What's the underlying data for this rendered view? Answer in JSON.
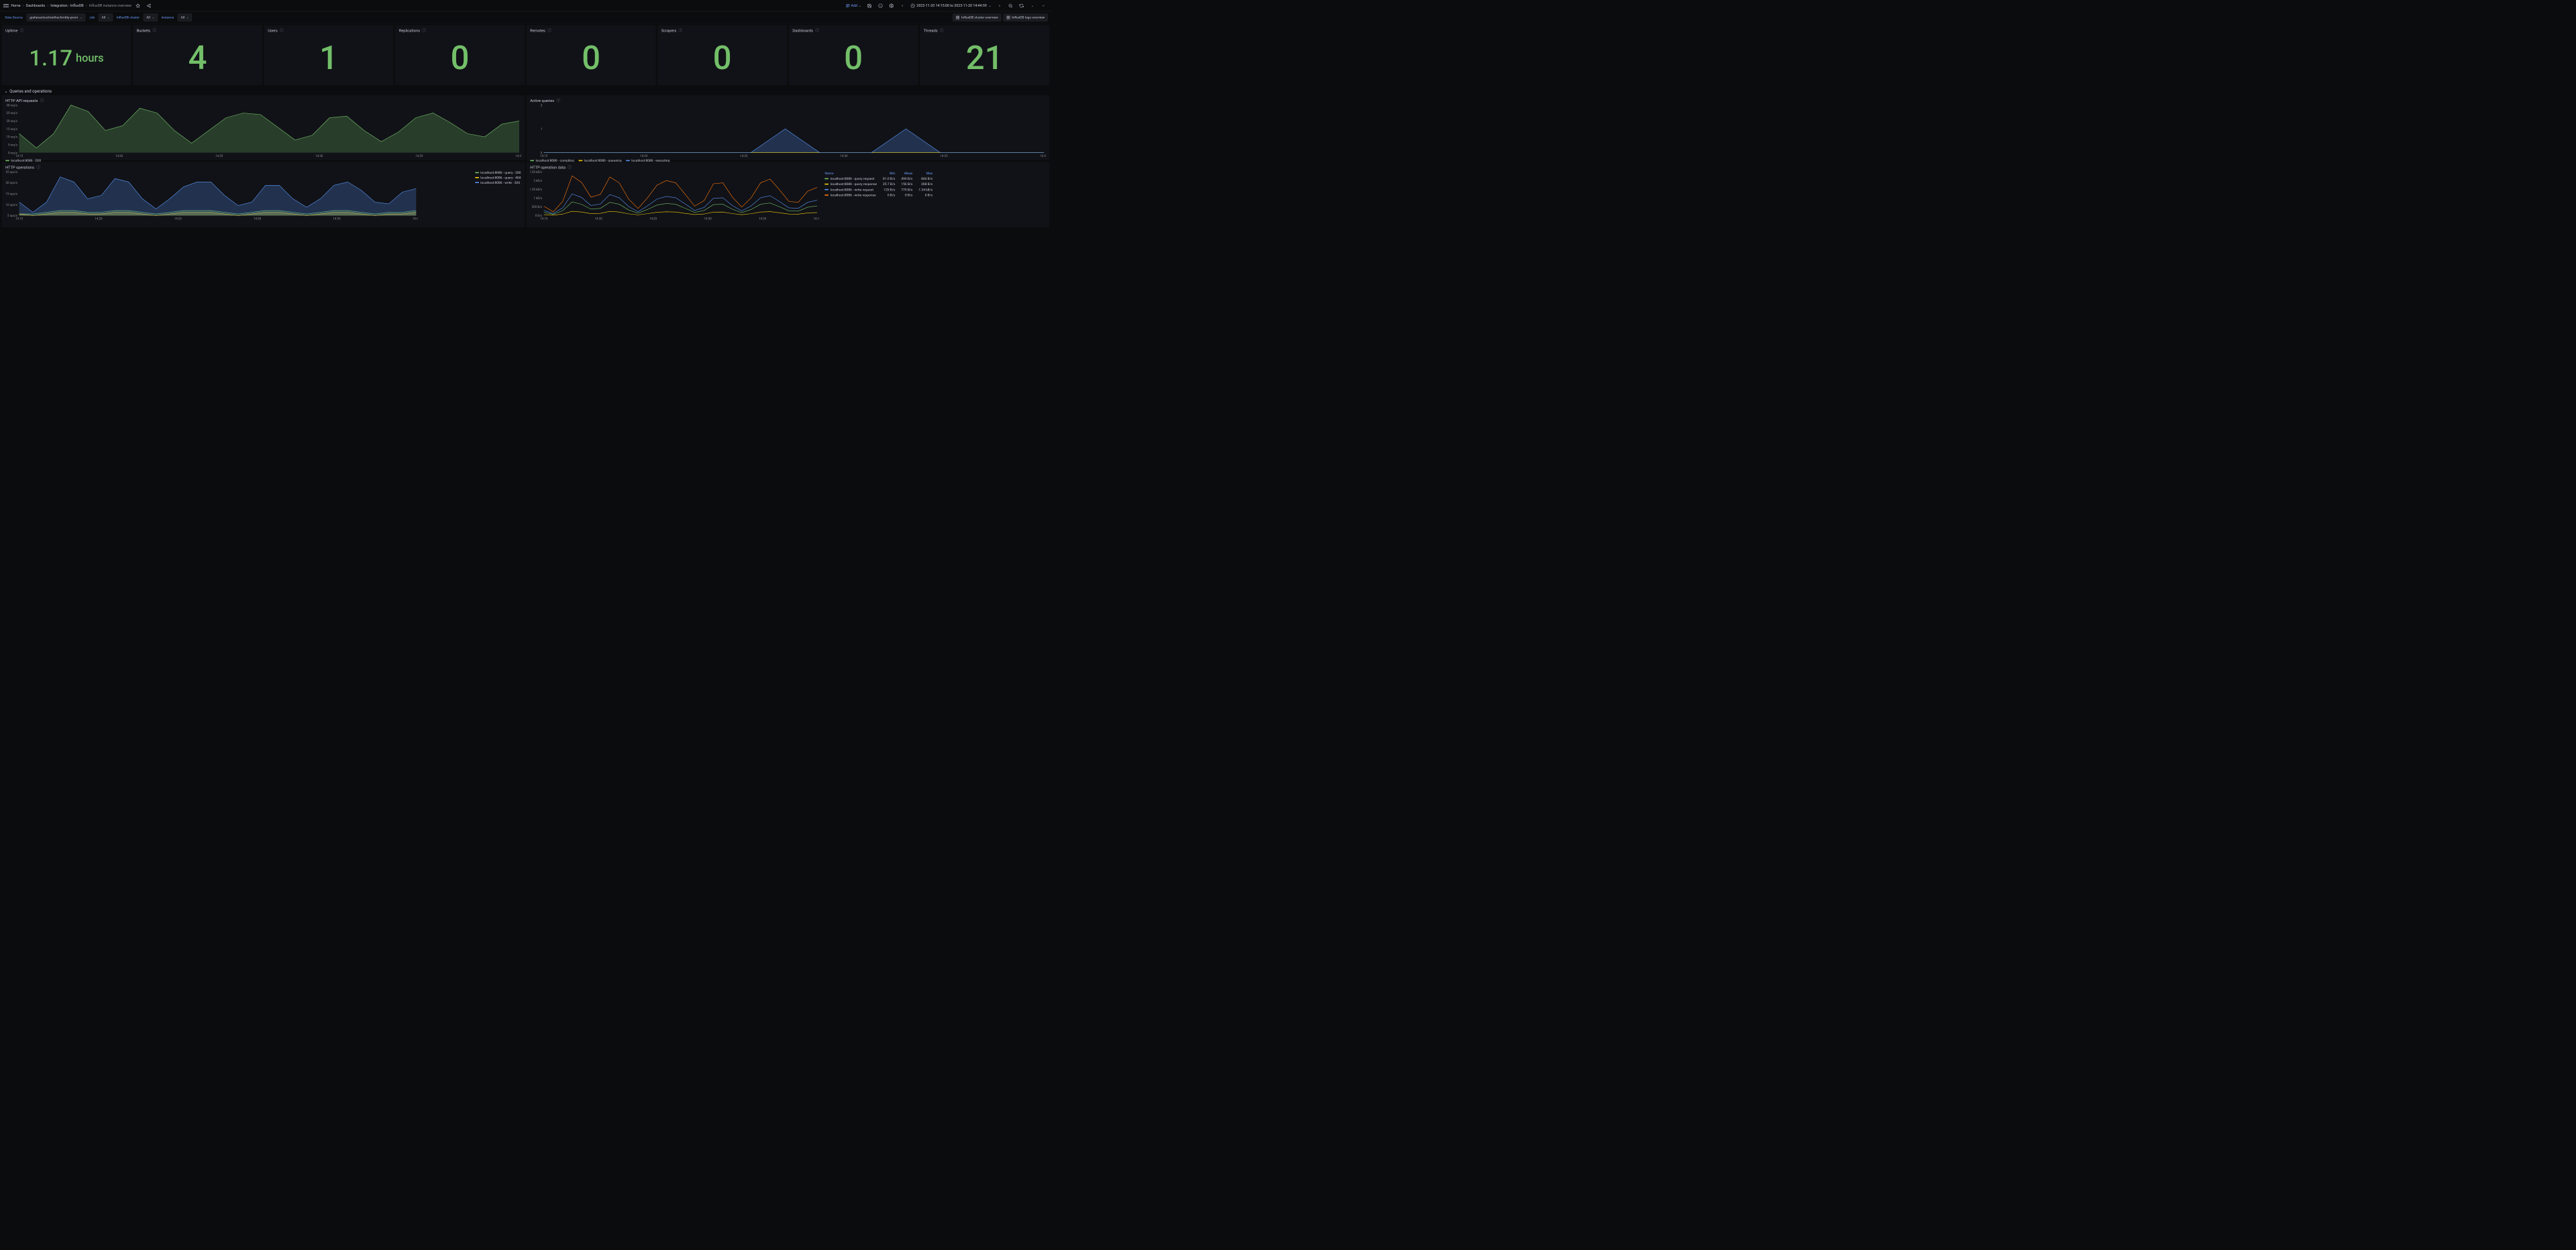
{
  "colors": {
    "green": "#73bf69",
    "yellow": "#f2cc0c",
    "blue": "#5794f2",
    "orange": "#ff780a"
  },
  "topbar": {
    "breadcrumb": [
      "Home",
      "Dashboards",
      "Integration - InfluxDB",
      "InfluxDB instance overview"
    ],
    "add_label": "Add",
    "time_range": "2023-11-20 14:15:00 to 2023-11-20 14:44:59"
  },
  "vars": {
    "data_source_label": "Data Source",
    "data_source_value": "grafanacloud-keithschmitty-prom",
    "job_label": "Job",
    "job_value": "All",
    "cluster_label": "InfluxDB cluster",
    "cluster_value": "All",
    "instance_label": "Instance",
    "instance_value": "All",
    "link_cluster": "InfluxDB cluster overview",
    "link_logs": "InfluxDB logs overview"
  },
  "stats": [
    {
      "title": "Uptime",
      "value": "1.17",
      "units": "hours"
    },
    {
      "title": "Buckets",
      "value": "4"
    },
    {
      "title": "Users",
      "value": "1"
    },
    {
      "title": "Replications",
      "value": "0"
    },
    {
      "title": "Remotes",
      "value": "0"
    },
    {
      "title": "Scrapers",
      "value": "0"
    },
    {
      "title": "Dashboards",
      "value": "0"
    },
    {
      "title": "Threads",
      "value": "21"
    }
  ],
  "row_header": "Queries and operations",
  "panels": {
    "http_api": {
      "title": "HTTP API requests",
      "legend": [
        "localhost:8086 - 2XX"
      ]
    },
    "active_queries": {
      "title": "Active queries",
      "legend": [
        "localhost:8086 - compiling",
        "localhost:8086 - queueing",
        "localhost:8086 - executing"
      ]
    },
    "http_ops": {
      "title": "HTTP operations",
      "legend": [
        "localhost:8086 - query - 200",
        "localhost:8086 - query - 404",
        "localhost:8086 - write - 204"
      ]
    },
    "http_op_data": {
      "title": "HTTP operation data",
      "headers": [
        "Name",
        "Min",
        "Mean",
        "Max"
      ],
      "rows": [
        {
          "name": "localhost:8086 - query request",
          "min": "81.0 B/s",
          "mean": "490 B/s",
          "max": "844 B/s"
        },
        {
          "name": "localhost:8086 - query response",
          "min": "25.7 B/s",
          "mean": "156 B/s",
          "max": "268 B/s"
        },
        {
          "name": "localhost:8086 - write request",
          "min": "129 B/s",
          "mean": "779 B/s",
          "max": "1.34 kB/s"
        },
        {
          "name": "localhost:8086 - write response",
          "min": "0 B/s",
          "mean": "0 B/s",
          "max": "0 B/s"
        }
      ]
    }
  },
  "chart_data": [
    {
      "id": "http_api",
      "type": "area",
      "xlabel": "",
      "ylabel": "req/s",
      "x_ticks": [
        "14:15",
        "14:20",
        "14:25",
        "14:30",
        "14:35",
        "14:40"
      ],
      "y_ticks": [
        "0 req/s",
        "5 req/s",
        "10 req/s",
        "15 req/s",
        "20 req/s",
        "25 req/s",
        "30 req/s"
      ],
      "ylim": [
        0,
        30
      ],
      "series": [
        {
          "name": "localhost:8086 - 2XX",
          "color": "#73bf69",
          "x": [
            0,
            1,
            2,
            3,
            4,
            5,
            6,
            7,
            8,
            9,
            10,
            11,
            12,
            13,
            14,
            15,
            16,
            17,
            18,
            19,
            20,
            21,
            22,
            23,
            24,
            25,
            26,
            27,
            28,
            29
          ],
          "values": [
            12,
            3,
            12,
            30,
            26,
            14,
            17,
            28,
            25,
            14,
            6,
            14,
            22,
            25,
            24,
            16,
            8,
            11,
            22,
            23,
            14,
            7,
            13,
            22,
            25,
            19,
            12,
            10,
            18,
            20
          ]
        }
      ]
    },
    {
      "id": "active_queries",
      "type": "area",
      "x_ticks": [
        "14:15",
        "14:20",
        "14:25",
        "14:30",
        "14:35",
        "14:40"
      ],
      "y_ticks": [
        "0",
        "1",
        "2"
      ],
      "ylim": [
        0,
        2
      ],
      "series": [
        {
          "name": "localhost:8086 - compiling",
          "color": "#73bf69",
          "values": [
            0,
            0,
            0,
            0,
            0,
            0,
            0,
            0,
            0,
            0,
            0,
            0,
            0,
            0,
            0,
            0,
            0,
            0,
            0,
            0,
            0,
            0,
            0,
            0,
            0,
            0,
            0,
            0,
            0,
            0
          ]
        },
        {
          "name": "localhost:8086 - queueing",
          "color": "#f2cc0c",
          "values": [
            0,
            0,
            0,
            0,
            0,
            0,
            0,
            0,
            0,
            0,
            0,
            0,
            0,
            0,
            0,
            0,
            0,
            0,
            0,
            0,
            0,
            0,
            0,
            0,
            0,
            0,
            0,
            0,
            0,
            0
          ]
        },
        {
          "name": "localhost:8086 - executing",
          "color": "#5794f2",
          "values": [
            0,
            0,
            0,
            0,
            0,
            0,
            0,
            0,
            0,
            0,
            0,
            0,
            0,
            0.5,
            1,
            0.5,
            0,
            0,
            0,
            0,
            0.5,
            1,
            0.5,
            0,
            0,
            0,
            0,
            0,
            0,
            0
          ]
        }
      ]
    },
    {
      "id": "http_ops",
      "type": "area",
      "x_ticks": [
        "14:15",
        "14:20",
        "14:25",
        "14:30",
        "14:35",
        "14:40"
      ],
      "y_ticks": [
        "5 ops/s",
        "10 ops/s",
        "15 ops/s",
        "20 ops/s",
        "25 ops/s"
      ],
      "ylim": [
        0,
        26
      ],
      "series": [
        {
          "name": "localhost:8086 - query - 200",
          "color": "#73bf69",
          "values": [
            1,
            1,
            2,
            3,
            3,
            2,
            2,
            3,
            3,
            2,
            1,
            2,
            3,
            3,
            3,
            2,
            1,
            2,
            3,
            3,
            2,
            1,
            2,
            3,
            3,
            2,
            1,
            2,
            2,
            3
          ]
        },
        {
          "name": "localhost:8086 - query - 404",
          "color": "#f2cc0c",
          "values": [
            1,
            0,
            1,
            2,
            2,
            1,
            1,
            2,
            2,
            1,
            0,
            1,
            2,
            2,
            2,
            1,
            0,
            1,
            2,
            2,
            1,
            0,
            1,
            2,
            2,
            1,
            0,
            1,
            1,
            2
          ]
        },
        {
          "name": "localhost:8086 - write - 204",
          "color": "#5794f2",
          "values": [
            8,
            2,
            8,
            23,
            20,
            10,
            12,
            22,
            20,
            10,
            4,
            10,
            17,
            20,
            20,
            12,
            6,
            8,
            18,
            18,
            10,
            5,
            10,
            18,
            20,
            15,
            8,
            7,
            14,
            16
          ]
        }
      ]
    },
    {
      "id": "http_op_data",
      "type": "line",
      "x_ticks": [
        "14:15",
        "14:20",
        "14:25",
        "14:30",
        "14:35",
        "14:40"
      ],
      "y_ticks": [
        "0 B/s",
        "500 B/s",
        "1 kB/s",
        "1.50 kB/s",
        "2 kB/s",
        "2.50 kB/s"
      ],
      "ylim": [
        0,
        2700
      ],
      "series": [
        {
          "name": "localhost:8086 - query request",
          "color": "#73bf69",
          "values": [
            200,
            81,
            300,
            844,
            700,
            400,
            450,
            820,
            700,
            350,
            150,
            380,
            650,
            750,
            700,
            450,
            200,
            320,
            680,
            700,
            400,
            180,
            380,
            700,
            780,
            550,
            300,
            280,
            520,
            600
          ]
        },
        {
          "name": "localhost:8086 - query response",
          "color": "#f2cc0c",
          "values": [
            60,
            26,
            95,
            268,
            220,
            125,
            140,
            260,
            220,
            110,
            48,
            120,
            205,
            235,
            220,
            140,
            65,
            100,
            215,
            220,
            125,
            55,
            120,
            220,
            245,
            175,
            95,
            90,
            165,
            190
          ]
        },
        {
          "name": "localhost:8086 - write request",
          "color": "#5794f2",
          "values": [
            320,
            129,
            480,
            1340,
            1120,
            620,
            720,
            1300,
            1100,
            560,
            240,
            600,
            1020,
            1180,
            1100,
            720,
            320,
            500,
            1070,
            1100,
            620,
            290,
            600,
            1100,
            1230,
            870,
            480,
            450,
            820,
            950
          ]
        },
        {
          "name": "localhost:8086 - write response",
          "color": "#ff780a",
          "values": [
            580,
            236,
            875,
            2450,
            2050,
            1140,
            1310,
            2380,
            2020,
            1020,
            438,
            1100,
            1875,
            2165,
            2020,
            1310,
            585,
            920,
            1965,
            2020,
            1145,
            525,
            1100,
            2020,
            2255,
            1595,
            875,
            820,
            1505,
            1740
          ]
        }
      ]
    }
  ]
}
